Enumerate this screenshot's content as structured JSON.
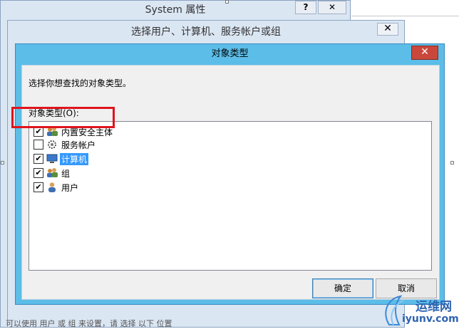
{
  "system_window": {
    "title": "System 属性",
    "help_label": "?",
    "close_label": "✕"
  },
  "select_window": {
    "title": "选择用户、计算机、服务帐户或组",
    "close_label": "✕",
    "footer_text": "可以使用 用户 或 组 来设置，请 选择 以下 位置"
  },
  "dialog": {
    "title": "对象类型",
    "close_label": "✕",
    "prompt": "选择你想查找的对象类型。",
    "list_label": "对象类型(O):",
    "items": [
      {
        "label": "内置安全主体",
        "checked": true,
        "icon": "security-principal-icon",
        "selected": false
      },
      {
        "label": "服务帐户",
        "checked": false,
        "icon": "service-account-icon",
        "selected": false
      },
      {
        "label": "计算机",
        "checked": true,
        "icon": "computer-icon",
        "selected": true
      },
      {
        "label": "组",
        "checked": true,
        "icon": "group-icon",
        "selected": false
      },
      {
        "label": "用户",
        "checked": true,
        "icon": "user-icon",
        "selected": false
      }
    ],
    "ok_label": "确定",
    "cancel_label": "取消"
  },
  "watermark": {
    "line1": "运维网",
    "line2": "iyunv.com"
  },
  "colors": {
    "dialog_title_bar": "#5bbde8",
    "close_red": "#c9483b",
    "highlight_red": "#e0141d",
    "selection_blue": "#3399ff"
  }
}
